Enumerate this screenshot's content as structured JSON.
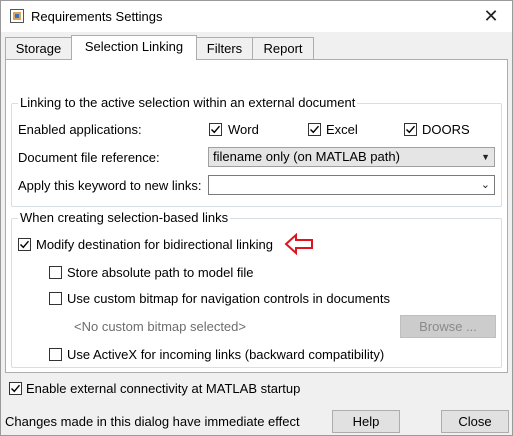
{
  "window": {
    "title": "Requirements Settings",
    "close_glyph": "✕"
  },
  "tabs": [
    {
      "label": "Storage"
    },
    {
      "label": "Selection Linking"
    },
    {
      "label": "Filters"
    },
    {
      "label": "Report"
    }
  ],
  "active_tab": "Selection Linking",
  "linking_group": {
    "legend": "Linking to the active selection within an external document",
    "enabled_label": "Enabled applications:",
    "apps": [
      {
        "label": "Word",
        "checked": true
      },
      {
        "label": "Excel",
        "checked": true
      },
      {
        "label": "DOORS",
        "checked": true
      }
    ],
    "doc_ref_label": "Document file reference:",
    "doc_ref_value": "filename only (on MATLAB path)",
    "keyword_label": "Apply this keyword to new links:",
    "keyword_value": ""
  },
  "selection_group": {
    "legend": "When creating selection-based links",
    "modify_dest": {
      "label": "Modify destination for bidirectional linking",
      "checked": true
    },
    "store_abs": {
      "label": "Store absolute path to model file",
      "checked": false
    },
    "custom_bitmap": {
      "label": "Use custom bitmap for navigation controls in documents",
      "checked": false
    },
    "bitmap_placeholder": "<No custom bitmap selected>",
    "browse_label": "Browse ...",
    "activex": {
      "label": "Use ActiveX for incoming links (backward compatibility)",
      "checked": false
    }
  },
  "external_connectivity": {
    "label": "Enable external connectivity at MATLAB startup",
    "checked": true
  },
  "status_text": "Changes made in this dialog have immediate effect",
  "buttons": {
    "help": "Help",
    "close": "Close"
  },
  "annotation": {
    "arrow_icon": "left-arrow-icon",
    "color": "#e0141e"
  },
  "colors": {
    "check": "#000000",
    "panel_border": "#adadad"
  }
}
